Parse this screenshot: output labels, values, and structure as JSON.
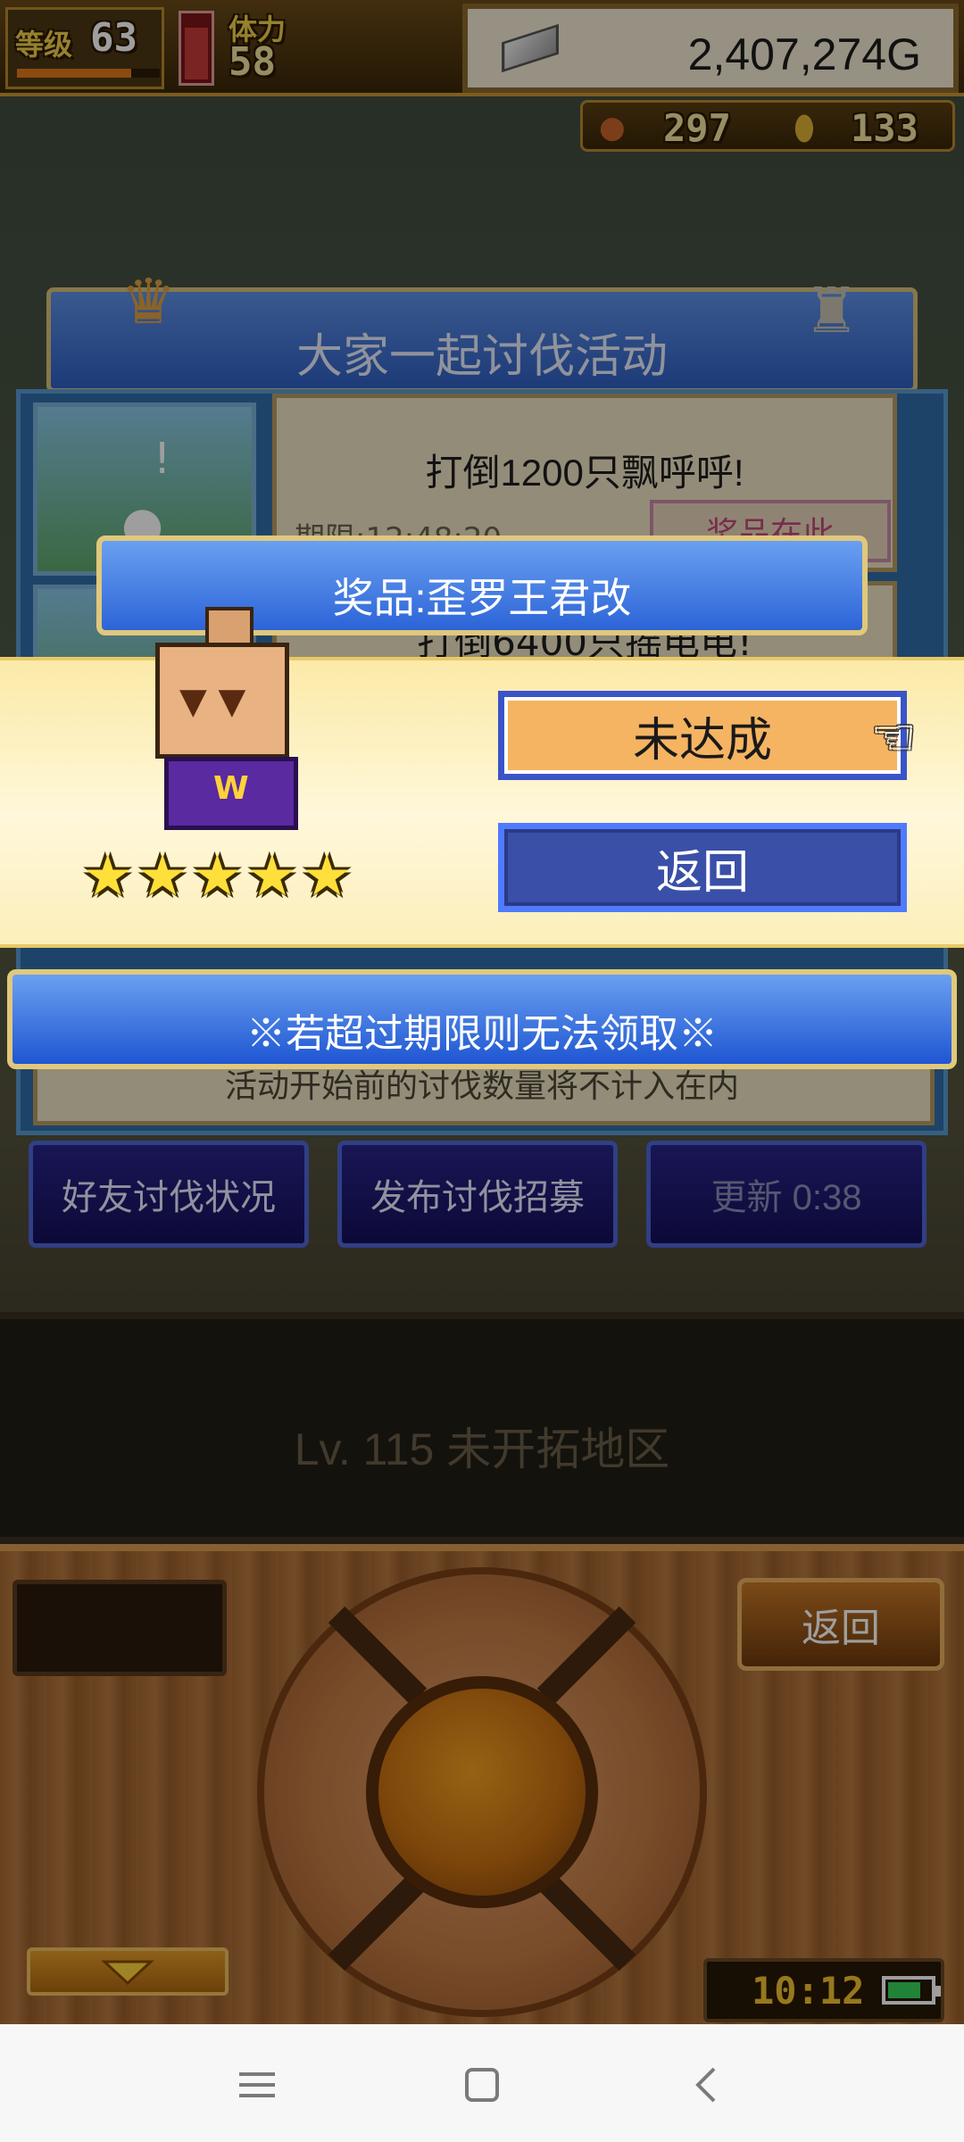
{
  "status": {
    "level_label": "等级",
    "level_value": "63",
    "stamina_label": "体力",
    "stamina_value": "58",
    "stamina_fraction": 0.75,
    "gold": "2,407,274G",
    "food_count": "297",
    "medal_count": "133"
  },
  "event": {
    "title": "大家一起讨伐活动",
    "quest1_title": "打倒1200只飘呼呼!",
    "quest1_period": "期限:12:48:20",
    "quest1_prize_button": "奖品在此",
    "quest2_title": "打倒6400只摇电电!",
    "footnote": "活动开始前的讨伐数量将不计入在内"
  },
  "popup": {
    "prize_title": "奖品:歪罗王君改",
    "status_button": "未达成",
    "back_button": "返回",
    "stars": 5,
    "star_glyph": "★",
    "notice": "※若超过期限则无法领取※"
  },
  "actions": {
    "friends_status": "好友讨伐状况",
    "post_recruit": "发布讨伐招募",
    "refresh": "更新 0:38"
  },
  "locked_area": {
    "label": "Lv. 115 未开拓地区"
  },
  "controller": {
    "back_button": "返回",
    "clock": "10:12",
    "battery_fraction": 0.8
  },
  "colors": {
    "accent_blue": "#2c64d8",
    "gold_border": "#e0c87c",
    "button_orange": "#f5b462",
    "star_yellow": "#ffe03a"
  }
}
